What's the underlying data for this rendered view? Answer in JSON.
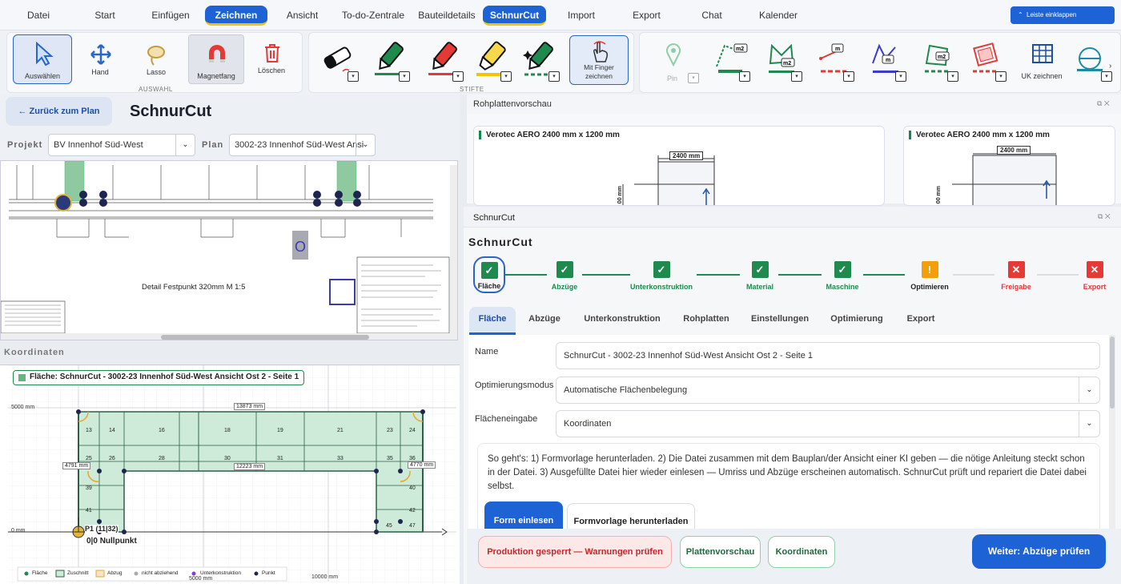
{
  "menu": {
    "items": [
      "Datei",
      "Start",
      "Einfügen",
      "Zeichnen",
      "Ansicht",
      "To-do-Zentrale",
      "Bauteildetails",
      "SchnurCut",
      "Import",
      "Export",
      "Chat",
      "Kalender"
    ],
    "collapse": "Leiste einklappen"
  },
  "toolbar": {
    "select": "Auswählen",
    "hand": "Hand",
    "lasso": "Lasso",
    "magnet": "Magnetfang",
    "delete": "Löschen",
    "group_auswahl": "AUSWAHL",
    "finger": "Mit Finger zeichnen",
    "group_stifte": "STIFTE",
    "pin": "Pin",
    "uk": "UK zeichnen",
    "m2": "m2",
    "m": "m"
  },
  "left": {
    "back": "← Zurück zum Plan",
    "title": "SchnurCut",
    "projekt_label": "Projekt",
    "projekt": "BV Innenhof Süd-West",
    "plan_label": "Plan",
    "plan": "3002-23 Innenhof Süd-West Ansi"
  },
  "plan": {
    "detail_text": "Detail Festpunkt 320mm  M 1:5",
    "marker": "O"
  },
  "coords": {
    "label": "Koordinaten",
    "flaeche": "Fläche: SchnurCut - 3002-23 Innenhof Süd-West Ansicht Ost 2 - Seite 1",
    "y5000": "5000 mm",
    "y0": "0 mm",
    "x5000": "5000 mm",
    "x10000": "10000 mm",
    "dim_top": "13873 mm",
    "dim_mid": "12223 mm",
    "dim_left": "4791 mm",
    "dim_right": "4770 mm",
    "p1": "P1 (11|32)",
    "null": "0|0 Nullpunkt",
    "cells_top": [
      "13",
      "14",
      "16",
      "18",
      "19",
      "21",
      "23",
      "24"
    ],
    "cells_mid": [
      "25",
      "26",
      "28",
      "30",
      "31",
      "33",
      "35",
      "36"
    ],
    "cells_side": [
      "39",
      "41",
      "40",
      "42",
      "45",
      "47"
    ],
    "legend": [
      "Fläche",
      "Zuschnitt",
      "Abzug",
      "nicht abziehend",
      "Unterkonstruktion",
      "Punkt"
    ]
  },
  "rohplatten": {
    "title": "Rohplattenvorschau",
    "card1": "Verotec AERO  2400 mm x 1200 mm",
    "card2": "Verotec AERO  2400 mm x 1200 mm",
    "dim": "2400 mm",
    "dim_v": "00 mm"
  },
  "schnurcut": {
    "head": "SchnurCut",
    "title": "SchnurCut",
    "steps": [
      "Fläche",
      "Abzüge",
      "Unterkonstruktion",
      "Material",
      "Maschine",
      "Optimieren",
      "Freigabe",
      "Export"
    ],
    "tabs": [
      "Fläche",
      "Abzüge",
      "Unterkonstruktion",
      "Rohplatten",
      "Einstellungen",
      "Optimierung",
      "Export"
    ],
    "name_label": "Name",
    "name": "SchnurCut - 3002-23 Innenhof Süd-West Ansicht Ost 2 - Seite 1",
    "modus_label": "Optimierungsmodus",
    "modus": "Automatische Flächenbelegung",
    "eingabe_label": "Flächeneingabe",
    "eingabe": "Koordinaten",
    "info": "So geht's: 1) Formvorlage herunterladen. 2) Die Datei zusammen mit dem Bauplan/der Ansicht einer KI geben — die nötige Anleitung steckt schon in der Datei. 3) Ausgefüllte Datei hier wieder einlesen — Umriss und Abzüge erscheinen automatisch. SchnurCut prüft und repariert die Datei dabei selbst.",
    "form_einlesen": "Form einlesen",
    "formvorlage": "Formvorlage herunterladen",
    "gesperrt": "Produktion gesperrt — Warnungen prüfen",
    "plattenvorschau": "Plattenvorschau",
    "koordinaten": "Koordinaten",
    "weiter": "Weiter: Abzüge prüfen"
  },
  "colors": {
    "accent": "#1e63d6",
    "green": "#1e8a4d",
    "orange": "#f59e0b",
    "red": "#e53935"
  }
}
